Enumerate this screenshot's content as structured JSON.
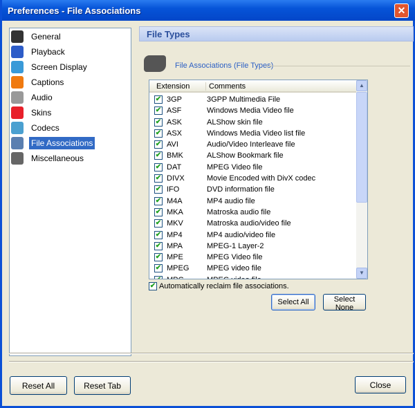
{
  "window": {
    "title": "Preferences - File Associations",
    "close": "✕"
  },
  "nav": {
    "items": [
      {
        "label": "General",
        "icon": "general-icon",
        "color": "#333"
      },
      {
        "label": "Playback",
        "icon": "playback-icon",
        "color": "#2d5cc8"
      },
      {
        "label": "Screen Display",
        "icon": "monitor-icon",
        "color": "#3a9ad8"
      },
      {
        "label": "Captions",
        "icon": "captions-icon",
        "color": "#f07a10"
      },
      {
        "label": "Audio",
        "icon": "microphone-icon",
        "color": "#999"
      },
      {
        "label": "Skins",
        "icon": "skins-icon",
        "color": "#e8202a"
      },
      {
        "label": "Codecs",
        "icon": "codecs-icon",
        "color": "#4aa0d0"
      },
      {
        "label": "File Associations",
        "icon": "file-associations-icon",
        "color": "#5a7fb0",
        "selected": true
      },
      {
        "label": "Miscellaneous",
        "icon": "miscellaneous-icon",
        "color": "#666"
      }
    ]
  },
  "section": {
    "title": "File Types",
    "group_label": "File Associations (File Types)"
  },
  "list": {
    "columns": [
      "Extension",
      "Comments"
    ],
    "rows": [
      {
        "ext": "3GP",
        "comment": "3GPP Multimedia File",
        "checked": true
      },
      {
        "ext": "ASF",
        "comment": "Windows Media Video file",
        "checked": true
      },
      {
        "ext": "ASK",
        "comment": "ALShow skin file",
        "checked": true
      },
      {
        "ext": "ASX",
        "comment": "Windows Media Video list file",
        "checked": true
      },
      {
        "ext": "AVI",
        "comment": "Audio/Video Interleave file",
        "checked": true
      },
      {
        "ext": "BMK",
        "comment": "ALShow Bookmark file",
        "checked": true
      },
      {
        "ext": "DAT",
        "comment": "MPEG Video file",
        "checked": true
      },
      {
        "ext": "DIVX",
        "comment": "Movie Encoded with DivX codec",
        "checked": true
      },
      {
        "ext": "IFO",
        "comment": "DVD information file",
        "checked": true
      },
      {
        "ext": "M4A",
        "comment": "MP4 audio file",
        "checked": true
      },
      {
        "ext": "MKA",
        "comment": "Matroska audio file",
        "checked": true
      },
      {
        "ext": "MKV",
        "comment": "Matroska audio/video file",
        "checked": true
      },
      {
        "ext": "MP4",
        "comment": "MP4 audio/video file",
        "checked": true
      },
      {
        "ext": "MPA",
        "comment": "MPEG-1 Layer-2",
        "checked": true
      },
      {
        "ext": "MPE",
        "comment": "MPEG Video file",
        "checked": true
      },
      {
        "ext": "MPEG",
        "comment": "MPEG video file",
        "checked": true
      },
      {
        "ext": "MPG",
        "comment": "MPEG video file",
        "checked": true
      }
    ]
  },
  "auto_reclaim": {
    "label": "Automatically reclaim file associations.",
    "checked": true
  },
  "buttons": {
    "select_all": "Select All",
    "select_none": "Select None",
    "reset_all": "Reset All",
    "reset_tab": "Reset Tab",
    "close": "Close"
  },
  "check_glyph": "✔"
}
